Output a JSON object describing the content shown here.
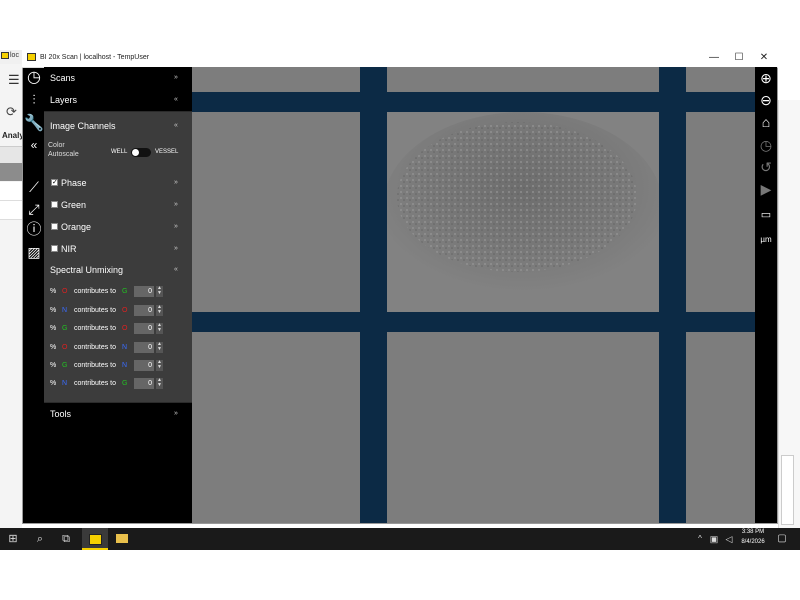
{
  "background_app": {
    "title_fragment": "loc",
    "tab_label": "Analy"
  },
  "window": {
    "title": "BI 20x Scan | localhost - TempUser"
  },
  "panel": {
    "scans_label": "Scans",
    "layers_label": "Layers",
    "image_channels_label": "Image Channels",
    "color_autoscale_label": "Color Autoscale",
    "toggle_left": "WELL",
    "toggle_right": "VESSEL",
    "channels": [
      {
        "label": "Phase",
        "checked": true
      },
      {
        "label": "Green",
        "checked": false
      },
      {
        "label": "Orange",
        "checked": false
      },
      {
        "label": "NIR",
        "checked": false
      }
    ],
    "spectral_unmixing_label": "Spectral Unmixing",
    "unmix_rows": [
      {
        "pct": "%",
        "from": "O",
        "from_color": "#e02020",
        "text": "contributes to",
        "to": "G",
        "to_color": "#22c022",
        "value": "0"
      },
      {
        "pct": "%",
        "from": "N",
        "from_color": "#3a6cff",
        "text": "contributes to",
        "to": "O",
        "to_color": "#e02020",
        "value": "0"
      },
      {
        "pct": "%",
        "from": "G",
        "from_color": "#22c022",
        "text": "contributes to",
        "to": "O",
        "to_color": "#e02020",
        "value": "0"
      },
      {
        "pct": "%",
        "from": "O",
        "from_color": "#e02020",
        "text": "contributes to",
        "to": "N",
        "to_color": "#3a6cff",
        "value": "0"
      },
      {
        "pct": "%",
        "from": "G",
        "from_color": "#22c022",
        "text": "contributes to",
        "to": "N",
        "to_color": "#3a6cff",
        "value": "0"
      },
      {
        "pct": "%",
        "from": "N",
        "from_color": "#3a6cff",
        "text": "contributes to",
        "to": "G",
        "to_color": "#22c022",
        "value": "0"
      }
    ],
    "tools_label": "Tools"
  },
  "right_toolbar": {
    "scale_label": "µm"
  },
  "taskbar": {
    "time": "3:38 PM",
    "date": "8/4/2026"
  },
  "colors": {
    "vessel_blue": "#0c2a45",
    "panel_dark": "#3c3c3c",
    "accent_yellow": "#f5d000"
  }
}
